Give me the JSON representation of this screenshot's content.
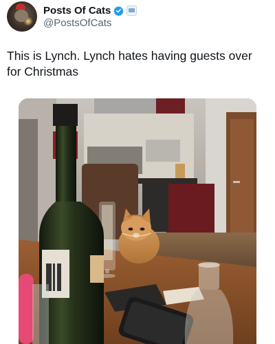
{
  "author": {
    "display_name": "Posts Of Cats",
    "handle": "@PostsOfCats",
    "avatar_icon": "cat-avatar",
    "verified_icon": "verified-badge-icon",
    "affiliate_icon": "affiliate-badge-icon",
    "verified_color": "#1d9bf0"
  },
  "tweet": {
    "text": "This is Lynch. Lynch hates having guests over for Christmas"
  },
  "media": {
    "type": "photo"
  }
}
